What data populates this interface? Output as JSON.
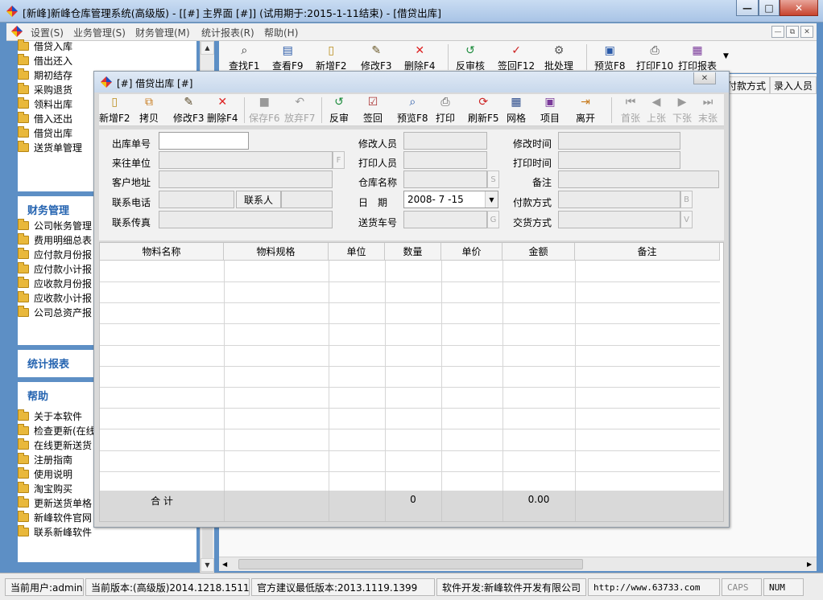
{
  "window": {
    "title": "[新峰]新峰仓库管理系统(高级版) - [[#] 主界面 [#]] (试用期于:2015-1-11结束) - [借贷出库]",
    "min": "—",
    "max": "□",
    "close": "✕"
  },
  "menu": [
    "设置(S)",
    "业务管理(S)",
    "财务管理(M)",
    "统计报表(R)",
    "帮助(H)"
  ],
  "mdi_buttons": [
    "—",
    "⧉",
    "✕"
  ],
  "left": {
    "business_items": [
      "借贷入库",
      "借出还入",
      "期初结存",
      "采购退货",
      "领料出库",
      "借入还出",
      "借贷出库",
      "送货单管理"
    ],
    "finance_title": "财务管理",
    "finance_items": [
      "公司帐务管理",
      "费用明细总表",
      "应付款月份报",
      "应付款小计报",
      "应收款月份报",
      "应收款小计报",
      "公司总资产报"
    ],
    "stats_title": "统计报表",
    "help_title": "帮助",
    "help_items": [
      "关于本软件",
      "检查更新(在线",
      "在线更新送货",
      "注册指南",
      "使用说明",
      "淘宝购买",
      "更新送货单格",
      "新峰软件官网",
      "联系新峰软件"
    ]
  },
  "main_toolbar": [
    "查找F1",
    "查看F9",
    "新增F2",
    "修改F3",
    "删除F4",
    "反审核",
    "签回F12",
    "批处理",
    "预览F8",
    "打印F10",
    "打印报表"
  ],
  "bg_grid_headers": [
    "付款方式",
    "录入人员"
  ],
  "child": {
    "title": "[#] 借贷出库 [#]",
    "close": "✕",
    "toolbar": [
      {
        "label": "新增F2",
        "icon": "new-doc",
        "enabled": true
      },
      {
        "label": "拷贝",
        "icon": "copy",
        "enabled": true
      },
      {
        "label": "修改F3",
        "icon": "edit",
        "enabled": true
      },
      {
        "label": "删除F4",
        "icon": "delete",
        "enabled": true
      },
      {
        "label": "保存F6",
        "icon": "save",
        "enabled": false
      },
      {
        "label": "放弃F7",
        "icon": "undo",
        "enabled": false
      },
      {
        "label": "反审",
        "icon": "reverse-audit",
        "enabled": true
      },
      {
        "label": "签回",
        "icon": "signback",
        "enabled": true
      },
      {
        "label": "预览F8",
        "icon": "preview",
        "enabled": true
      },
      {
        "label": "打印",
        "icon": "print",
        "enabled": true
      },
      {
        "label": "刷新F5",
        "icon": "refresh",
        "enabled": true
      },
      {
        "label": "网格",
        "icon": "grid",
        "enabled": true
      },
      {
        "label": "项目",
        "icon": "project",
        "enabled": true
      },
      {
        "label": "离开",
        "icon": "exit",
        "enabled": true
      },
      {
        "label": "首张",
        "icon": "first",
        "enabled": false
      },
      {
        "label": "上张",
        "icon": "prev",
        "enabled": false
      },
      {
        "label": "下张",
        "icon": "next",
        "enabled": false
      },
      {
        "label": "末张",
        "icon": "last",
        "enabled": false
      }
    ],
    "form": {
      "order_no": "出库单号",
      "partner": "来往单位",
      "partner_btn": "F",
      "address": "客户地址",
      "phone": "联系电话",
      "contact": "联系人",
      "fax": "联系传真",
      "modifier": "修改人员",
      "printer": "打印人员",
      "warehouse": "仓库名称",
      "warehouse_btn": "S",
      "date_label": "日　期",
      "date_value": "2008- 7 -15",
      "vehicle": "送货车号",
      "vehicle_btn": "G",
      "modify_time": "修改时间",
      "print_time": "打印时间",
      "remark": "备注",
      "payment": "付款方式",
      "payment_btn": "B",
      "delivery": "交货方式",
      "delivery_btn": "V"
    },
    "grid": {
      "headers": [
        "物料名称",
        "物料规格",
        "单位",
        "数量",
        "单价",
        "金额",
        "备注"
      ],
      "total_label": "合 计",
      "total_qty": "0",
      "total_amount": "0.00"
    }
  },
  "status": {
    "user": "当前用户:admin",
    "version": "当前版本:(高级版)2014.1218.1511",
    "min_version": "官方建议最低版本:2013.1119.1399",
    "developer": "软件开发:新峰软件开发有限公司",
    "url": "http://www.63733.com",
    "caps": "CAPS",
    "num": "NUM"
  }
}
